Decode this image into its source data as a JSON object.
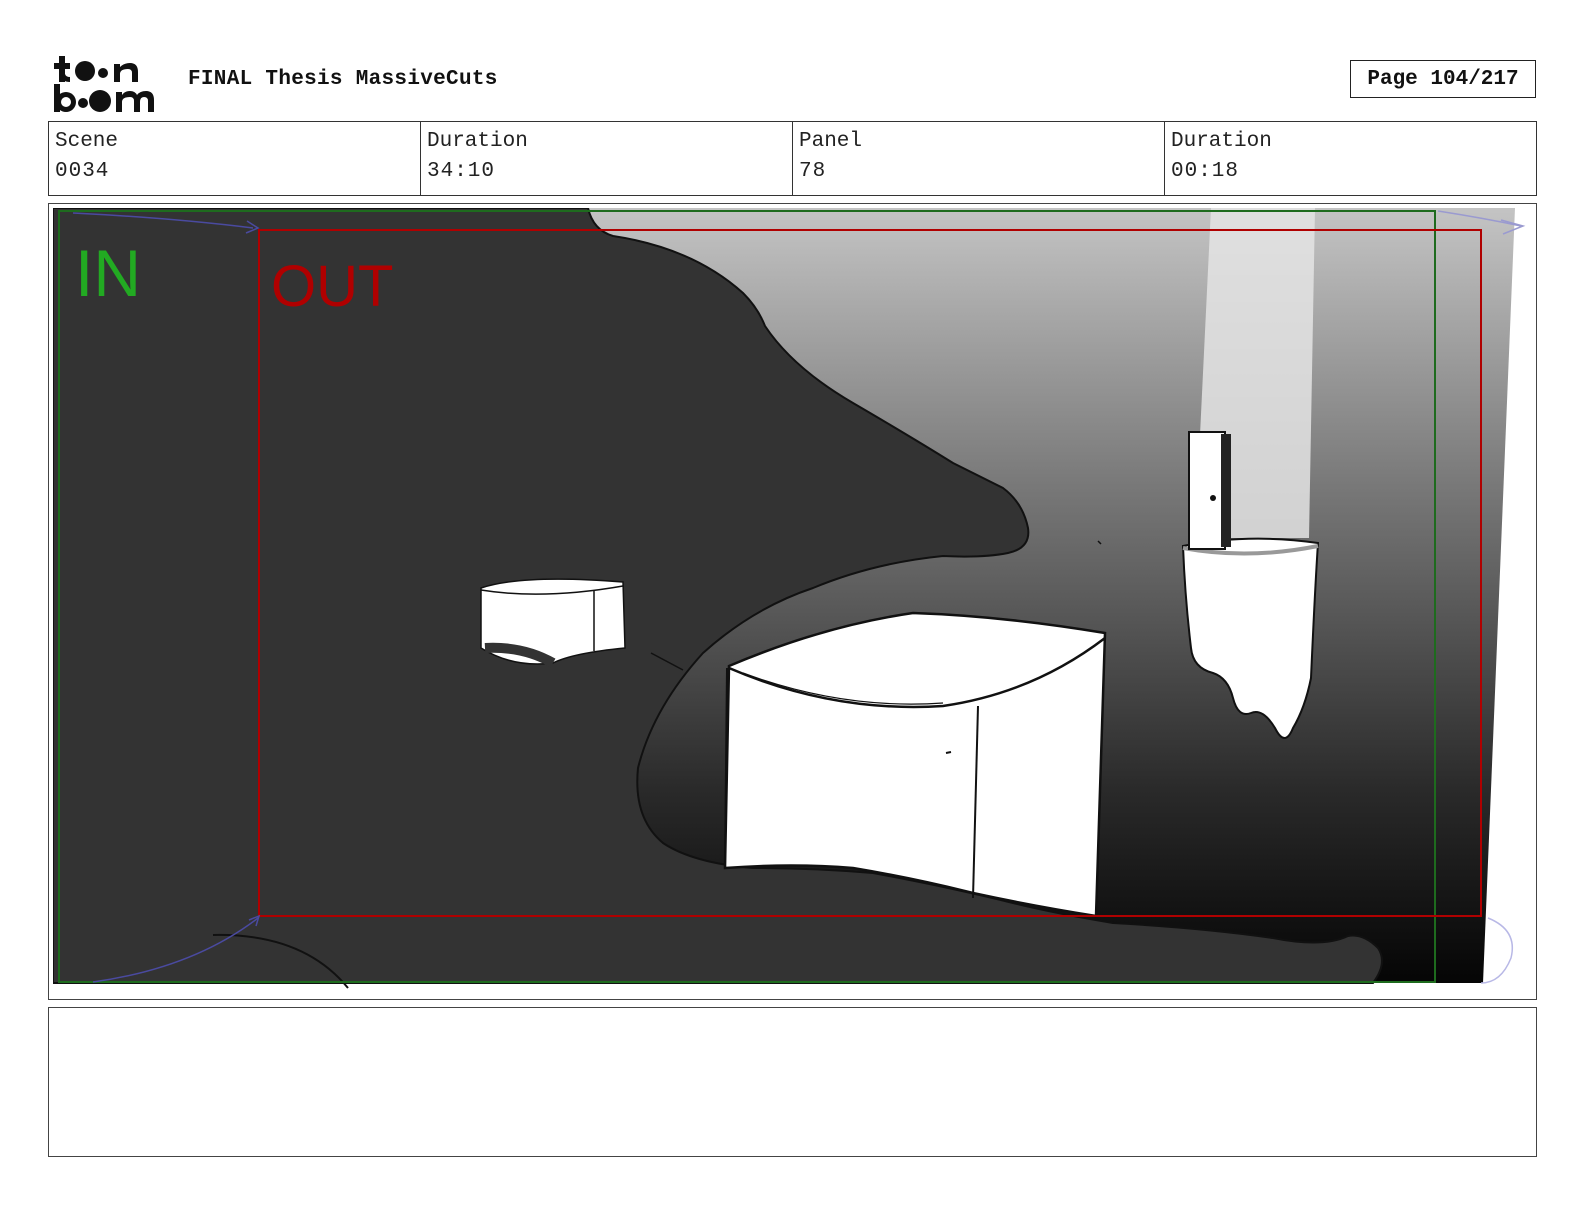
{
  "header": {
    "logo_line1": "toon",
    "logo_line2": "boom",
    "project_title": "FINAL Thesis MassiveCuts",
    "page_indicator": "Page 104/217"
  },
  "info": [
    {
      "label": "Scene",
      "value": "0034"
    },
    {
      "label": "Duration",
      "value": "34:10"
    },
    {
      "label": "Panel",
      "value": "78"
    },
    {
      "label": "Duration",
      "value": "00:18"
    }
  ],
  "panel": {
    "in_label": "IN",
    "out_label": "OUT",
    "colors": {
      "in_frame": "#1e6b1e",
      "in_text": "#22aa22",
      "out_frame": "#b00000",
      "out_text": "#b00000",
      "dark_rock": "#333333",
      "light_beam": "#e6e6e6"
    }
  },
  "notes": {
    "text": ""
  }
}
